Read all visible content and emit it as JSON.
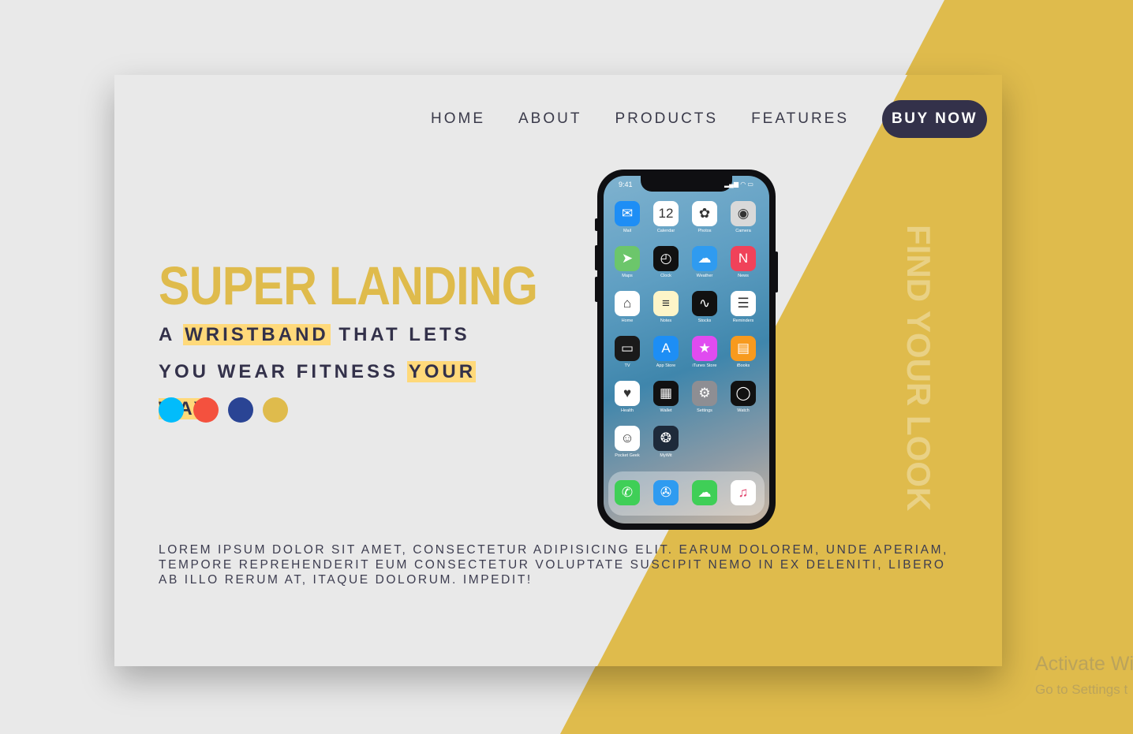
{
  "colors": {
    "accent_yellow": "#dfbb4c",
    "dark": "#33314a",
    "background": "#e9e9e9",
    "highlight": "#ffd97a"
  },
  "nav": {
    "links": [
      "HOME",
      "ABOUT",
      "PRODUCTS",
      "FEATURES"
    ],
    "buy_label": "BUY NOW"
  },
  "hero": {
    "title": "SUPER LANDING",
    "sub_a": "A ",
    "sub_hl1": "WRISTBAND",
    "sub_b": " THAT LETS YOU WEAR FITNESS ",
    "sub_hl2": "YOUR WAY",
    "sub_c": "."
  },
  "color_options": [
    "#02bcfb",
    "#f4513e",
    "#2a4494",
    "#dfbb4c"
  ],
  "vertical_text": "FIND YOUR LOOK",
  "paragraph": "Lorem ipsum dolor sit amet, consectetur adipisicing elit. Earum dolorem, unde aperiam, tempore reprehenderit eum consectetur voluptate suscipit nemo in ex deleniti, libero ab illo rerum at, itaque dolorum. Impedit!",
  "phone": {
    "time": "9:41",
    "apps": [
      {
        "label": "Mail",
        "icon": "mail-icon",
        "glyph": "✉",
        "bg": "#1e8ef5"
      },
      {
        "label": "Calendar",
        "icon": "calendar-icon",
        "glyph": "12",
        "bg": "#ffffff"
      },
      {
        "label": "Photos",
        "icon": "photos-icon",
        "glyph": "✿",
        "bg": "#ffffff"
      },
      {
        "label": "Camera",
        "icon": "camera-icon",
        "glyph": "◉",
        "bg": "#d9d9d9"
      },
      {
        "label": "Maps",
        "icon": "maps-icon",
        "glyph": "➤",
        "bg": "#6cc66b"
      },
      {
        "label": "Clock",
        "icon": "clock-icon",
        "glyph": "◴",
        "bg": "#111111"
      },
      {
        "label": "Weather",
        "icon": "weather-icon",
        "glyph": "☁",
        "bg": "#2f9bf0"
      },
      {
        "label": "News",
        "icon": "news-icon",
        "glyph": "N",
        "bg": "#f0425a"
      },
      {
        "label": "Home",
        "icon": "home-icon",
        "glyph": "⌂",
        "bg": "#ffffff"
      },
      {
        "label": "Notes",
        "icon": "notes-icon",
        "glyph": "≡",
        "bg": "#fdf5c8"
      },
      {
        "label": "Stocks",
        "icon": "stocks-icon",
        "glyph": "∿",
        "bg": "#111111"
      },
      {
        "label": "Reminders",
        "icon": "reminders-icon",
        "glyph": "☰",
        "bg": "#ffffff"
      },
      {
        "label": "TV",
        "icon": "tv-icon",
        "glyph": "▭",
        "bg": "#1a1a1a"
      },
      {
        "label": "App Store",
        "icon": "app-store-icon",
        "glyph": "A",
        "bg": "#1d8ef5"
      },
      {
        "label": "iTunes Store",
        "icon": "itunes-store-icon",
        "glyph": "★",
        "bg": "#e04bf0"
      },
      {
        "label": "iBooks",
        "icon": "ibooks-icon",
        "glyph": "▤",
        "bg": "#f79a1e"
      },
      {
        "label": "Health",
        "icon": "health-icon",
        "glyph": "♥",
        "bg": "#ffffff"
      },
      {
        "label": "Wallet",
        "icon": "wallet-icon",
        "glyph": "▦",
        "bg": "#111111"
      },
      {
        "label": "Settings",
        "icon": "settings-icon",
        "glyph": "⚙",
        "bg": "#8e8e93"
      },
      {
        "label": "Watch",
        "icon": "watch-icon",
        "glyph": "◯",
        "bg": "#111111"
      },
      {
        "label": "Pocket Geek",
        "icon": "pocket-geek-icon",
        "glyph": "☺",
        "bg": "#ffffff"
      },
      {
        "label": "MyWit",
        "icon": "mywit-icon",
        "glyph": "❂",
        "bg": "#1e2a3a"
      }
    ],
    "dock": [
      {
        "icon": "phone-icon",
        "glyph": "✆",
        "bg": "#3fcf57"
      },
      {
        "icon": "safari-icon",
        "glyph": "✇",
        "bg": "#2f9bf0"
      },
      {
        "icon": "messages-icon",
        "glyph": "☁",
        "bg": "#3fcf57"
      },
      {
        "icon": "music-icon",
        "glyph": "♫",
        "bg": "#ffffff"
      }
    ]
  },
  "watermark": {
    "line1": "Activate Wi",
    "line2": "Go to Settings t"
  }
}
